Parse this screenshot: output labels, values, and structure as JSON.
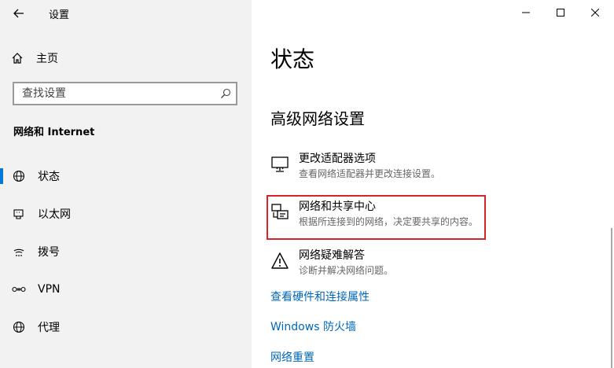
{
  "window": {
    "title": "设置"
  },
  "sidebar": {
    "home_label": "主页",
    "search_placeholder": "查找设置",
    "section_title": "网络和 Internet",
    "items": [
      {
        "label": "状态",
        "icon": "globe-icon",
        "active": true
      },
      {
        "label": "以太网",
        "icon": "ethernet-icon",
        "active": false
      },
      {
        "label": "拨号",
        "icon": "dialup-icon",
        "active": false
      },
      {
        "label": "VPN",
        "icon": "vpn-icon",
        "active": false
      },
      {
        "label": "代理",
        "icon": "globe-icon",
        "active": false
      }
    ]
  },
  "main": {
    "title": "状态",
    "subheading": "高级网络设置",
    "settings": [
      {
        "title": "更改适配器选项",
        "desc": "查看网络适配器并更改连接设置。",
        "icon": "adapter-icon"
      },
      {
        "title": "网络和共享中心",
        "desc": "根据所连接到的网络，决定要共享的内容。",
        "icon": "sharing-center-icon"
      },
      {
        "title": "网络疑难解答",
        "desc": "诊断并解决网络问题。",
        "icon": "warning-icon"
      }
    ],
    "links": [
      "查看硬件和连接属性",
      "Windows 防火墙",
      "网络重置"
    ]
  },
  "colors": {
    "accent": "#0078d7",
    "link": "#0067b8",
    "highlight": "#d5252b"
  }
}
